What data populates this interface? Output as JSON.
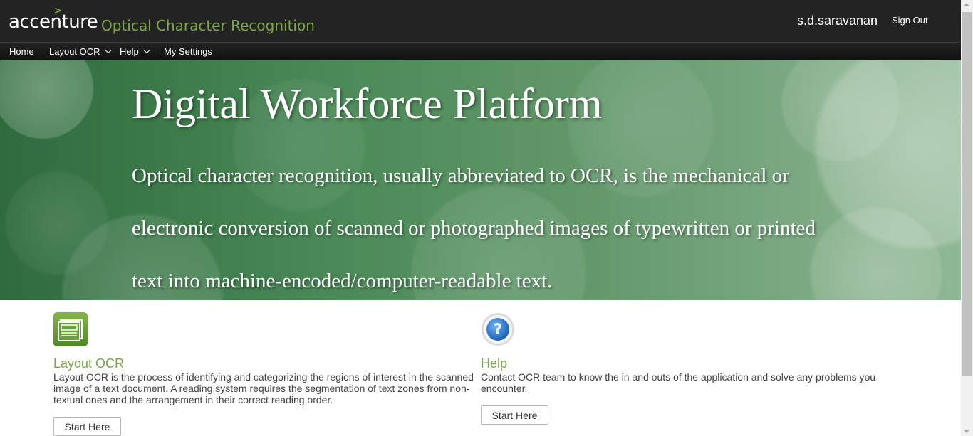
{
  "header": {
    "brand": "accenture",
    "brand_mark": ">",
    "app_title": "Optical Character Recognition",
    "username": "s.d.saravanan",
    "sign_out": "Sign Out"
  },
  "nav": {
    "home": "Home",
    "layout_ocr": "Layout OCR",
    "help": "Help",
    "my_settings": "My Settings"
  },
  "hero": {
    "title": "Digital Workforce Platform",
    "description": "Optical character recognition, usually abbreviated to OCR, is the mechanical or electronic conversion of scanned or photographed images of typewritten or printed text into machine-encoded/computer-readable text."
  },
  "cards": [
    {
      "title": "Layout OCR",
      "text": "Layout OCR is the process of identifying and categorizing the regions of interest in the scanned image of a text document. A reading system requires the segmentation of text zones from non-textual ones and the arrangement in their correct reading order.",
      "button": "Start Here",
      "icon": "layout-document-icon"
    },
    {
      "title": "Help",
      "text": "Contact OCR team to know the in and outs of the application and solve any problems you encounter.",
      "button": "Start Here",
      "icon": "question-mark-icon"
    }
  ],
  "colors": {
    "topbar": "#232323",
    "accent_green": "#7da64a",
    "hero_green": "#4b8a58"
  }
}
